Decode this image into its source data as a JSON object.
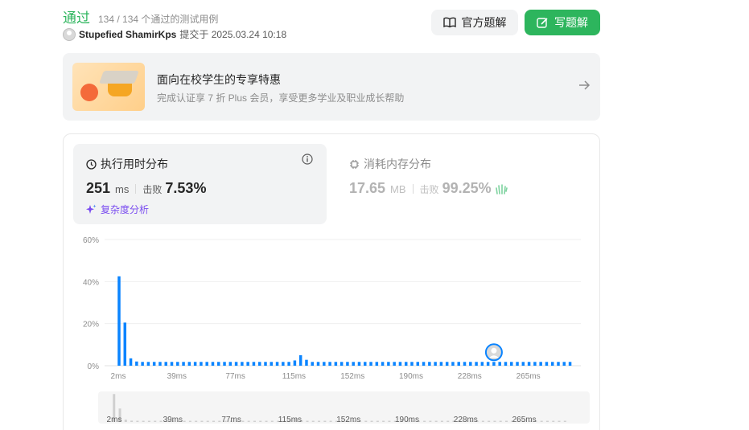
{
  "status": {
    "result": "通过",
    "passed_text": "134 / 134 个通过的测试用例"
  },
  "submitter": {
    "name": "Stupefied ShamirKps",
    "submitted_at": "提交于 2025.03.24 10:18"
  },
  "actions": {
    "official_solution": "官方题解",
    "write_solution": "写题解"
  },
  "promo": {
    "title": "面向在校学生的专享特惠",
    "subtitle": "完成认证享 7 折 Plus 会员，享受更多学业及职业成长帮助"
  },
  "runtime": {
    "title": "执行用时分布",
    "value": "251",
    "unit": "ms",
    "beat_label": "击败",
    "beat_percent": "7.53%",
    "analysis_label": "复杂度分析"
  },
  "memory": {
    "title": "消耗内存分布",
    "value": "17.65",
    "unit": "MB",
    "beat_label": "击败",
    "beat_percent": "99.25%"
  },
  "colors": {
    "accent_green": "#2db55d",
    "bar_blue": "#0a84ff",
    "analysis_purple": "#7a4cf0"
  },
  "chart_data": {
    "type": "bar",
    "y_ticks": [
      "60%",
      "40%",
      "20%",
      "0%"
    ],
    "ylim": [
      0,
      60
    ],
    "x_tick_labels": [
      "2ms",
      "39ms",
      "77ms",
      "115ms",
      "152ms",
      "190ms",
      "228ms",
      "265ms"
    ],
    "x_tick_indices": [
      0,
      10,
      20,
      30,
      40,
      50,
      60,
      70
    ],
    "values": [
      42.5,
      20.5,
      3.5,
      2,
      1.8,
      1.8,
      1.8,
      1.8,
      1.8,
      1.8,
      1.8,
      1.8,
      1.8,
      1.8,
      1.8,
      1.8,
      1.8,
      1.8,
      1.8,
      1.8,
      1.8,
      1.8,
      1.8,
      1.8,
      1.8,
      1.8,
      1.8,
      1.8,
      1.8,
      1.8,
      2.5,
      5,
      2.8,
      1.8,
      1.8,
      1.8,
      1.8,
      1.8,
      1.8,
      1.8,
      1.8,
      1.8,
      1.8,
      1.8,
      1.8,
      1.8,
      1.8,
      1.8,
      1.8,
      1.8,
      1.8,
      1.8,
      1.8,
      1.8,
      1.8,
      1.8,
      1.8,
      1.8,
      1.8,
      1.8,
      1.8,
      1.8,
      1.8,
      1.8,
      1.8,
      1.8,
      1.8,
      1.8,
      1.8,
      1.8,
      1.8,
      1.8,
      1.8,
      1.8,
      1.8,
      1.8,
      1.8,
      1.8
    ],
    "user_bar_index": 64,
    "grid": true,
    "brush_x_tick_labels": [
      "2ms",
      "39ms",
      "77ms",
      "115ms",
      "152ms",
      "190ms",
      "228ms",
      "265ms"
    ]
  }
}
